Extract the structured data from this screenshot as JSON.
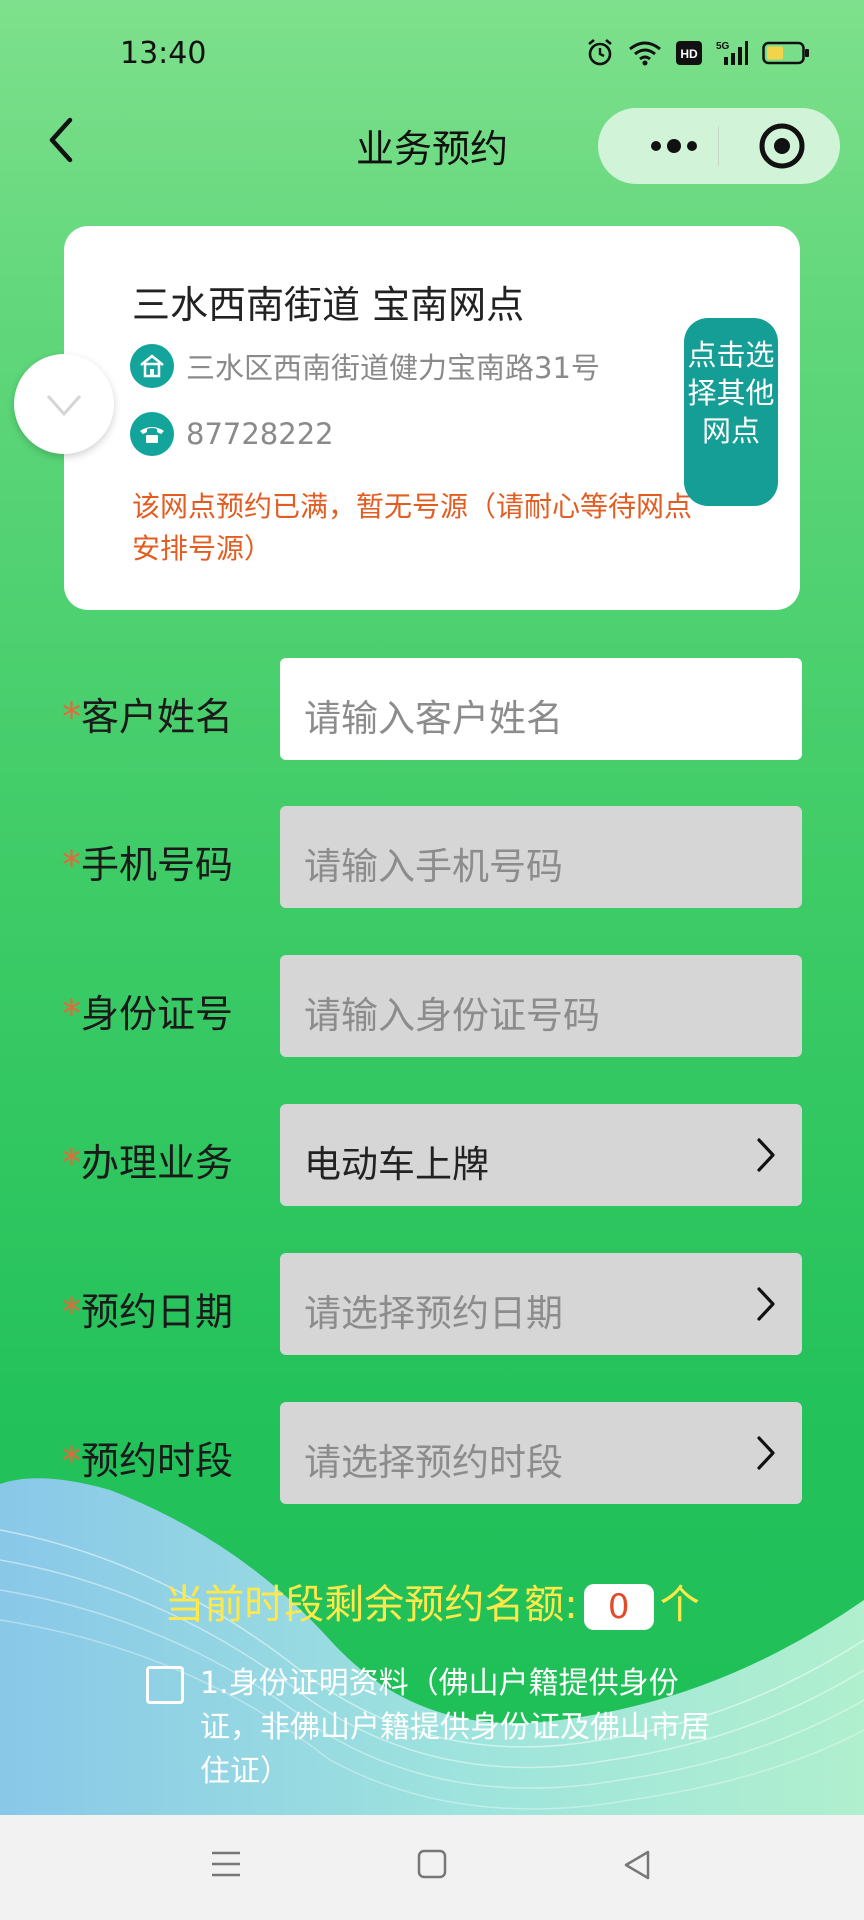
{
  "status_bar": {
    "time": "13:40",
    "icons": [
      "alarm-icon",
      "wifi-icon",
      "hd-icon",
      "5g-signal-icon",
      "battery-icon"
    ],
    "hd_label": "HD",
    "network_label": "5G"
  },
  "nav": {
    "title": "业务预约",
    "back_icon": "chevron-left-icon",
    "more_icon": "more-dots-icon",
    "close_icon": "target-circle-icon"
  },
  "branch_card": {
    "name": "三水西南街道 宝南网点",
    "address": "三水区西南街道健力宝南路31号",
    "phone": "87728222",
    "notice": "该网点预约已满，暂无号源（请耐心等待网点安排号源）",
    "select_button": "点击选择其他网点"
  },
  "form": {
    "required_mark": "*",
    "fields": [
      {
        "label": "客户姓名",
        "placeholder": "请输入客户姓名",
        "value": "",
        "arrow": false,
        "enabled": true
      },
      {
        "label": "手机号码",
        "placeholder": "请输入手机号码",
        "value": "",
        "arrow": false,
        "enabled": false
      },
      {
        "label": "身份证号",
        "placeholder": "请输入身份证号码",
        "value": "",
        "arrow": false,
        "enabled": false
      },
      {
        "label": "办理业务",
        "placeholder": "",
        "value": "电动车上牌",
        "arrow": true,
        "enabled": false
      },
      {
        "label": "预约日期",
        "placeholder": "请选择预约日期",
        "value": "",
        "arrow": true,
        "enabled": false
      },
      {
        "label": "预约时段",
        "placeholder": "请选择预约时段",
        "value": "",
        "arrow": true,
        "enabled": false
      }
    ]
  },
  "quota": {
    "prefix": "当前时段剩余预约名额:",
    "count": "0",
    "suffix": "个"
  },
  "requirements": [
    {
      "text": "1.身份证明资料（佛山户籍提供身份证，非佛山户籍提供身份证及佛山市居住证）",
      "checked": false
    }
  ],
  "system_nav": [
    "menu-icon",
    "home-square-icon",
    "back-triangle-icon"
  ],
  "colors": {
    "accent_teal": "#149e95",
    "notice_orange": "#e35d22",
    "required_red": "#e8673a",
    "quota_yellow": "#ffe94a",
    "background_green": "#3fcc67"
  }
}
